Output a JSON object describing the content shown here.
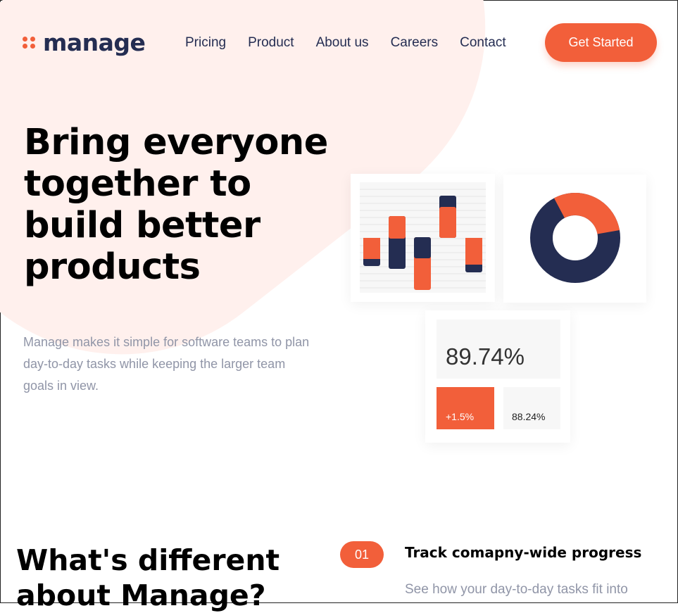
{
  "brand": {
    "name": "manage",
    "accent": "#f25f3a",
    "navy": "#242d52"
  },
  "nav": {
    "items": [
      "Pricing",
      "Product",
      "About us",
      "Careers",
      "Contact"
    ]
  },
  "cta": {
    "label": "Get Started"
  },
  "hero": {
    "title": "Bring everyone together to build better products",
    "description": "Manage makes it simple for software teams to plan day-to-day tasks while keeping the larger team goals in view."
  },
  "stats": {
    "main": "89.74%",
    "left": "+1.5%",
    "right": "88.24%"
  },
  "donut": {
    "orange_fraction": 0.3,
    "navy_fraction": 0.7
  },
  "section": {
    "title": "What's different about Manage?",
    "feature_number": "01",
    "feature_title": "Track comapny-wide progress",
    "feature_desc": "See how your day-to-day tasks fit into"
  }
}
